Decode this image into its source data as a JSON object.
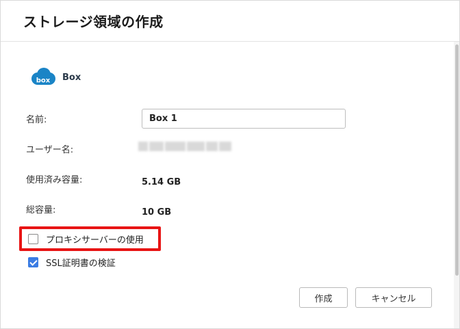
{
  "dialog": {
    "title": "ストレージ領域の作成"
  },
  "provider": {
    "logo_text": "box",
    "name": "Box",
    "brand_color": "#1a84c6"
  },
  "form": {
    "name_label": "名前:",
    "name_value": "Box 1",
    "username_label": "ユーザー名:",
    "used_label": "使用済み容量:",
    "used_value": "5.14 GB",
    "total_label": "総容量:",
    "total_value": "10 GB"
  },
  "options": {
    "proxy": {
      "label": "プロキシサーバーの使用",
      "checked": false
    },
    "ssl": {
      "label": "SSL証明書の検証",
      "checked": true
    }
  },
  "buttons": {
    "create": "作成",
    "cancel": "キャンセル"
  },
  "colors": {
    "accent": "#3b7ce3",
    "highlight": "#e81414"
  }
}
